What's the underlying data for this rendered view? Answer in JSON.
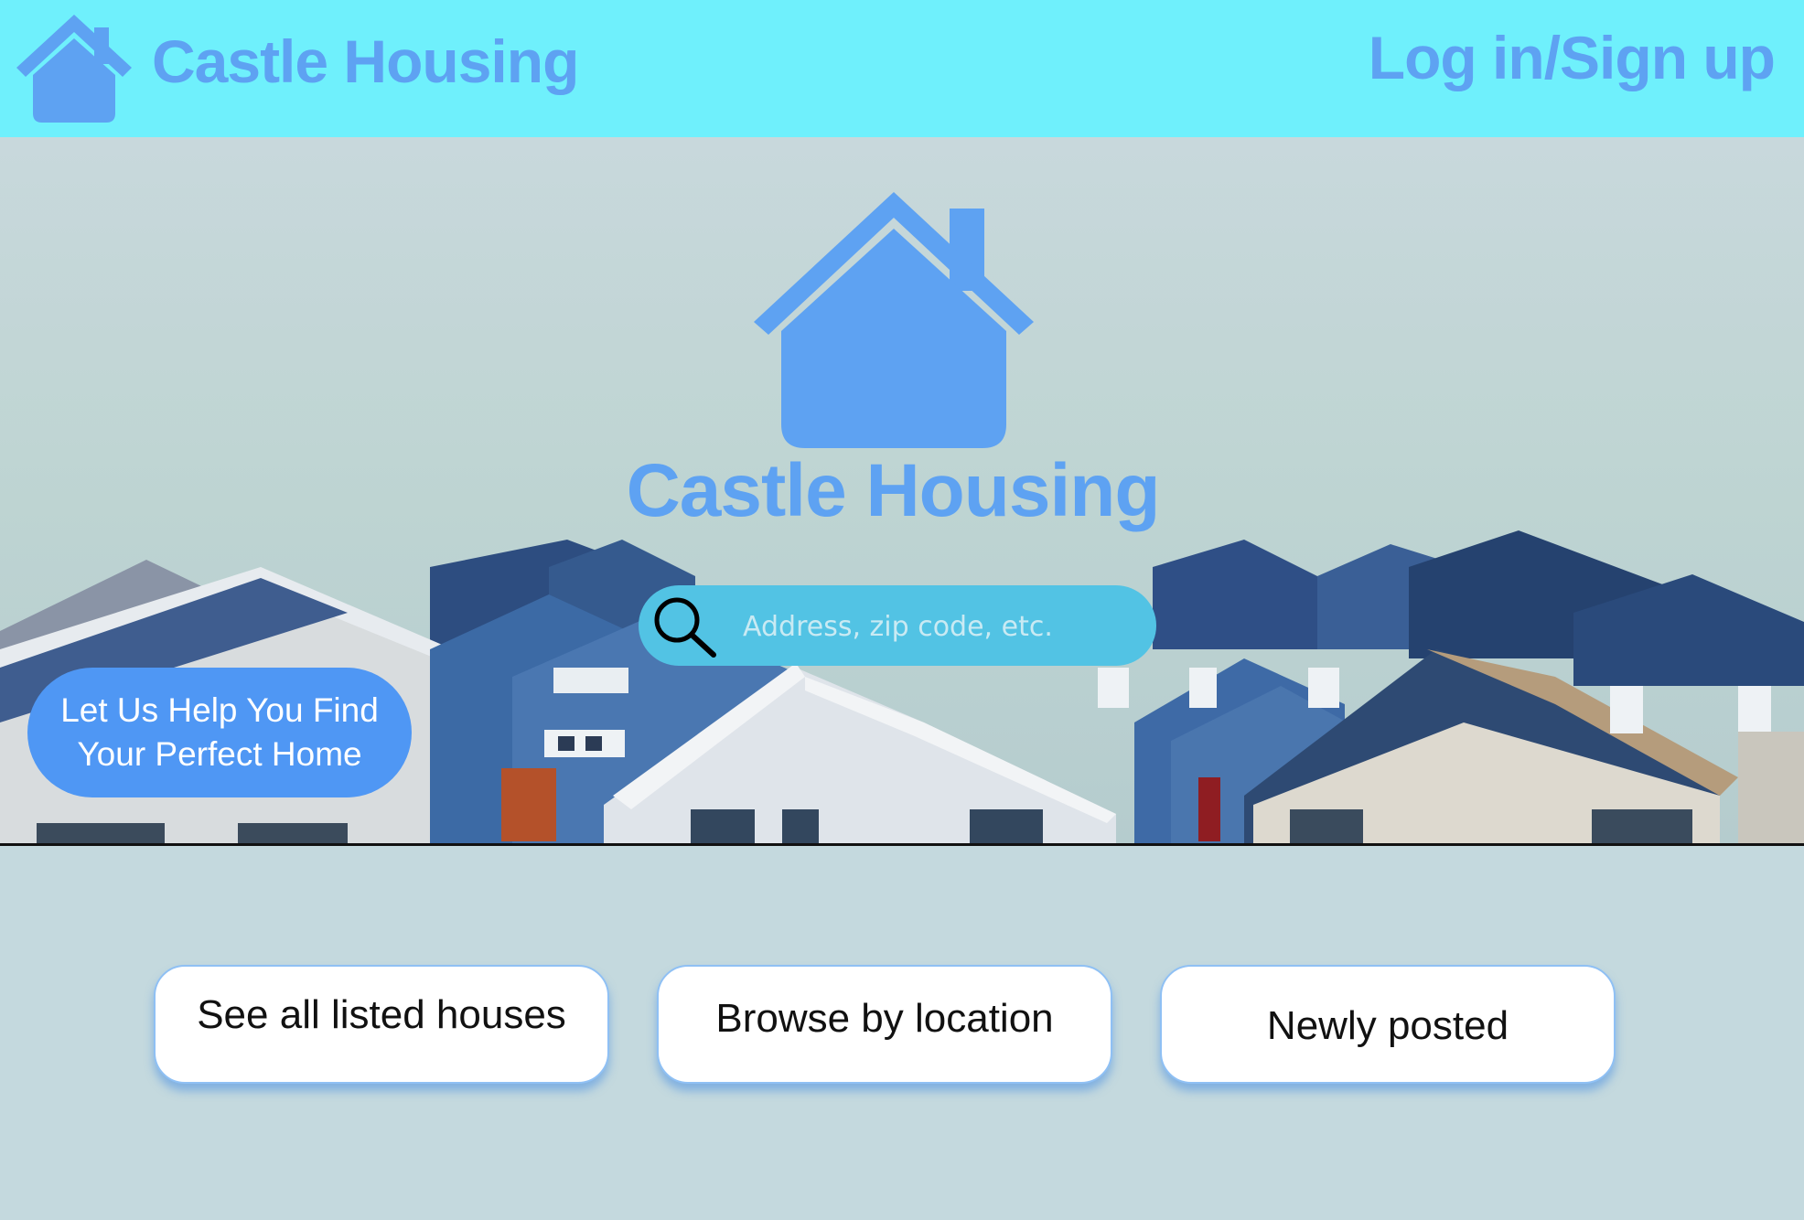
{
  "header": {
    "brand": "Castle Housing",
    "login_label": "Log in/Sign up",
    "logo_icon": "house-icon"
  },
  "hero": {
    "brand": "Castle Housing",
    "logo_icon": "house-icon",
    "background": "photo of suburban houses under a pale sky",
    "cta_line1": "Let Us Help You Find",
    "cta_line2": "Your Perfect Home"
  },
  "search": {
    "placeholder": "Address, zip code, etc.",
    "value": "",
    "icon": "search-icon"
  },
  "actions": {
    "all_listed": "See all listed houses",
    "by_location": "Browse by location",
    "newly_posted": "Newly posted"
  },
  "colors": {
    "header_bg": "#6ff0fc",
    "brand_blue": "#5ea2f2",
    "cta_blue": "#4f97f4",
    "search_bg": "#52c3e4",
    "page_bg": "#c4d9de"
  }
}
